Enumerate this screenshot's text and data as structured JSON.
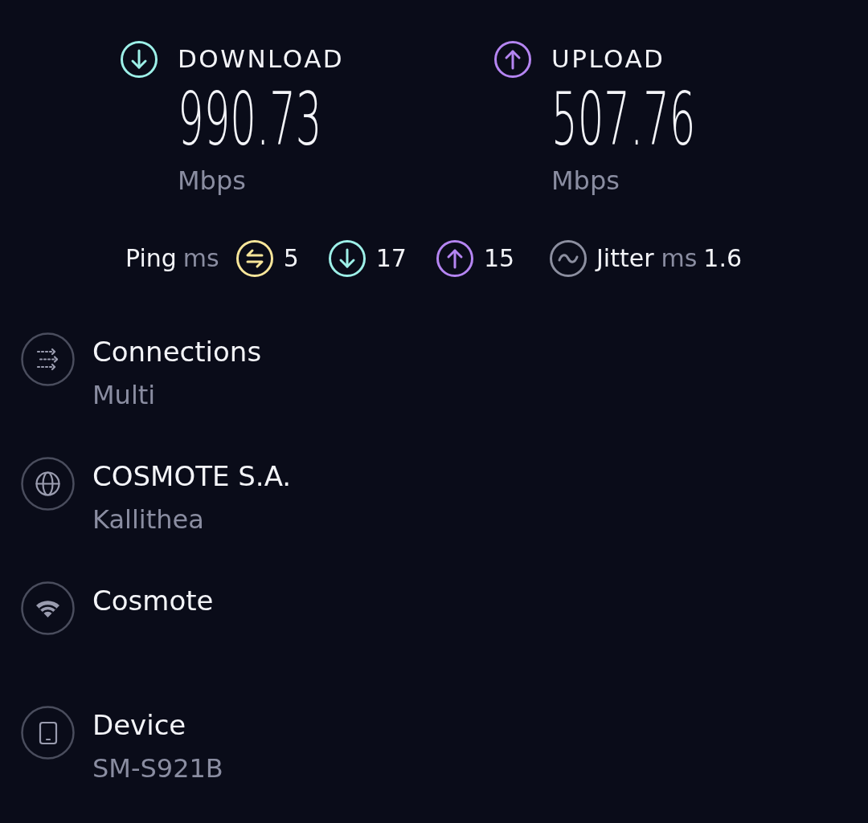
{
  "results": [
    {
      "kind": "download",
      "label": "DOWNLOAD",
      "value": "990.73",
      "unit": "Mbps"
    },
    {
      "kind": "upload",
      "label": "UPLOAD",
      "value": "507.76",
      "unit": "Mbps"
    }
  ],
  "latency": {
    "label": "Ping",
    "unit": "ms",
    "readings": [
      {
        "kind": "idle",
        "value": "5"
      },
      {
        "kind": "download",
        "value": "17"
      },
      {
        "kind": "upload",
        "value": "15"
      }
    ]
  },
  "jitter": {
    "label": "Jitter",
    "unit": "ms",
    "value": "1.6"
  },
  "details": [
    {
      "kind": "connections",
      "title": "Connections",
      "subtitle": "Multi"
    },
    {
      "kind": "provider",
      "title": "COSMOTE S.A.",
      "subtitle": "Kallithea"
    },
    {
      "kind": "network",
      "title": "Cosmote"
    },
    {
      "kind": "device",
      "title": "Device",
      "subtitle": "SM-S921B"
    }
  ]
}
